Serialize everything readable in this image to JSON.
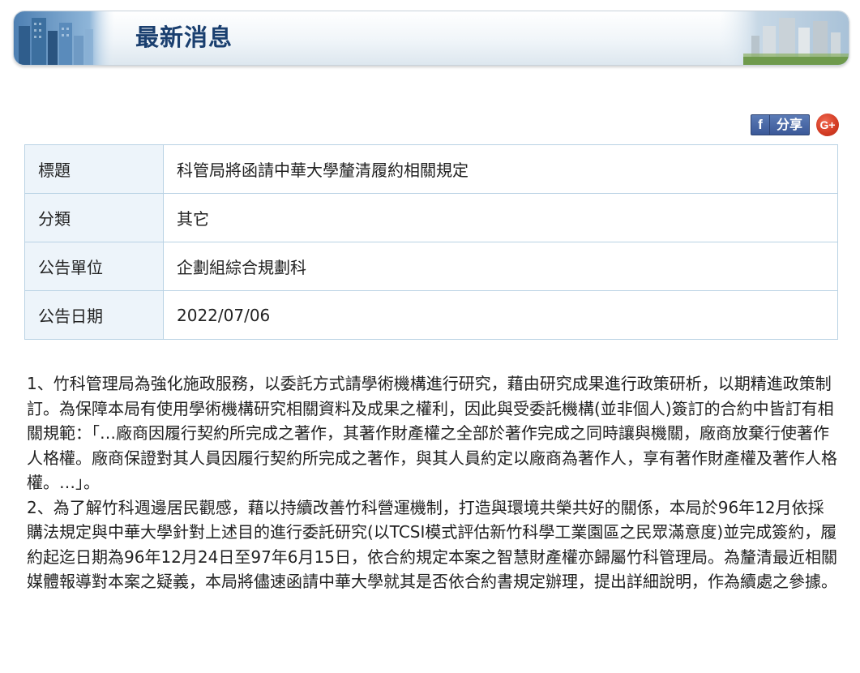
{
  "banner": {
    "title": "最新消息"
  },
  "share": {
    "facebook_icon": "f",
    "facebook_label": "分享",
    "gplus_icon": "G+"
  },
  "info": {
    "rows": [
      {
        "label": "標題",
        "value": "科管局將函請中華大學釐清履約相關規定"
      },
      {
        "label": "分類",
        "value": "其它"
      },
      {
        "label": "公告單位",
        "value": "企劃組綜合規劃科"
      },
      {
        "label": "公告日期",
        "value": "2022/07/06"
      }
    ]
  },
  "content": {
    "paragraphs": [
      "1、竹科管理局為強化施政服務，以委託方式請學術機構進行研究，藉由研究成果進行政策研析，以期精進政策制訂。為保障本局有使用學術機構研究相關資料及成果之權利，因此與受委託機構(並非個人)簽訂的合約中皆訂有相關規範：「…廠商因履行契約所完成之著作，其著作財產權之全部於著作完成之同時讓與機關，廠商放棄行使著作人格權。廠商保證對其人員因履行契約所完成之著作，與其人員約定以廠商為著作人，享有著作財產權及著作人格權。…」。",
      "2、為了解竹科週邊居民觀感，藉以持續改善竹科營運機制，打造與環境共榮共好的關係，本局於96年12月依採購法規定與中華大學針對上述目的進行委託研究(以TCSI模式評估新竹科學工業園區之民眾滿意度)並完成簽約，履約起迄日期為96年12月24日至97年6月15日，依合約規定本案之智慧財產權亦歸屬竹科管理局。為釐清最近相關媒體報導對本案之疑義，本局將儘速函請中華大學就其是否依合約書規定辦理，提出詳細說明，作為續處之參據。"
    ]
  },
  "colors": {
    "title": "#1a3f6f",
    "table_border": "#b9d2e4",
    "label_bg": "#edf4fa",
    "facebook": "#3b5998",
    "gplus": "#d23b23"
  }
}
